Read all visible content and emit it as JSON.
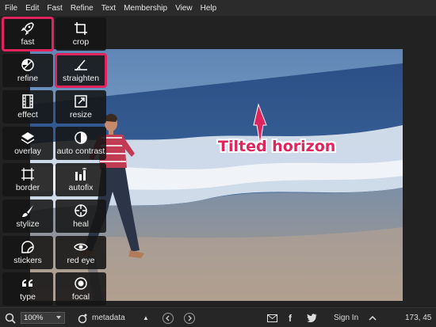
{
  "menu": [
    "File",
    "Edit",
    "Fast",
    "Refine",
    "Text",
    "Membership",
    "View",
    "Help"
  ],
  "tools": [
    {
      "label": "fast",
      "icon": "rocket-icon",
      "highlight": true
    },
    {
      "label": "crop",
      "icon": "crop-icon"
    },
    {
      "label": "refine",
      "icon": "refine-icon"
    },
    {
      "label": "straighten",
      "icon": "straighten-icon",
      "highlight": true
    },
    {
      "label": "effect",
      "icon": "film-icon"
    },
    {
      "label": "resize",
      "icon": "resize-icon"
    },
    {
      "label": "overlay",
      "icon": "layers-icon"
    },
    {
      "label": "auto contrast",
      "icon": "contrast-icon"
    },
    {
      "label": "border",
      "icon": "border-icon"
    },
    {
      "label": "autofix",
      "icon": "magic-wand-icon"
    },
    {
      "label": "stylize",
      "icon": "brush-icon"
    },
    {
      "label": "heal",
      "icon": "crosshair-icon"
    },
    {
      "label": "stickers",
      "icon": "sticker-icon"
    },
    {
      "label": "red eye",
      "icon": "eye-icon"
    },
    {
      "label": "type",
      "icon": "quote-icon"
    },
    {
      "label": "focal",
      "icon": "focal-icon"
    }
  ],
  "annotation": "Tilted horizon",
  "bottom": {
    "zoom": "100%",
    "metadata": "metadata",
    "sign_in": "Sign In",
    "coords": "173, 45"
  },
  "colors": {
    "highlight": "#e0245e",
    "toolbg": "#141414"
  }
}
